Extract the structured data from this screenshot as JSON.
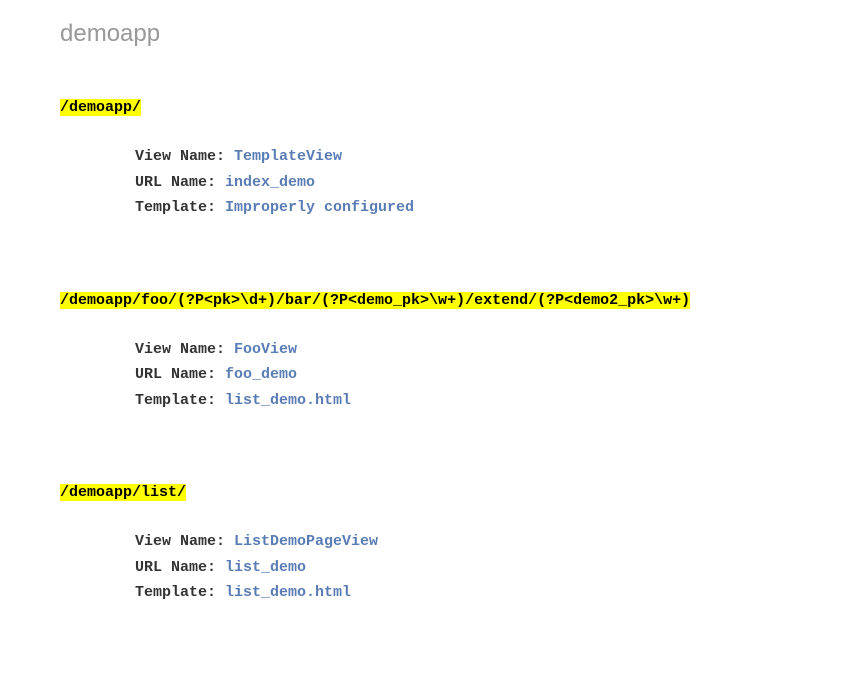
{
  "title": "demoapp",
  "labels": {
    "view_name": "View Name: ",
    "url_name": "URL Name: ",
    "template": "Template: "
  },
  "routes": [
    {
      "url": "/demoapp/",
      "view_name": "TemplateView",
      "url_name": "index_demo",
      "template": "Improperly configured"
    },
    {
      "url": "/demoapp/foo/(?P<pk>\\d+)/bar/(?P<demo_pk>\\w+)/extend/(?P<demo2_pk>\\w+)",
      "view_name": "FooView",
      "url_name": "foo_demo",
      "template": "list_demo.html"
    },
    {
      "url": "/demoapp/list/",
      "view_name": "ListDemoPageView",
      "url_name": "list_demo",
      "template": "list_demo.html"
    }
  ]
}
